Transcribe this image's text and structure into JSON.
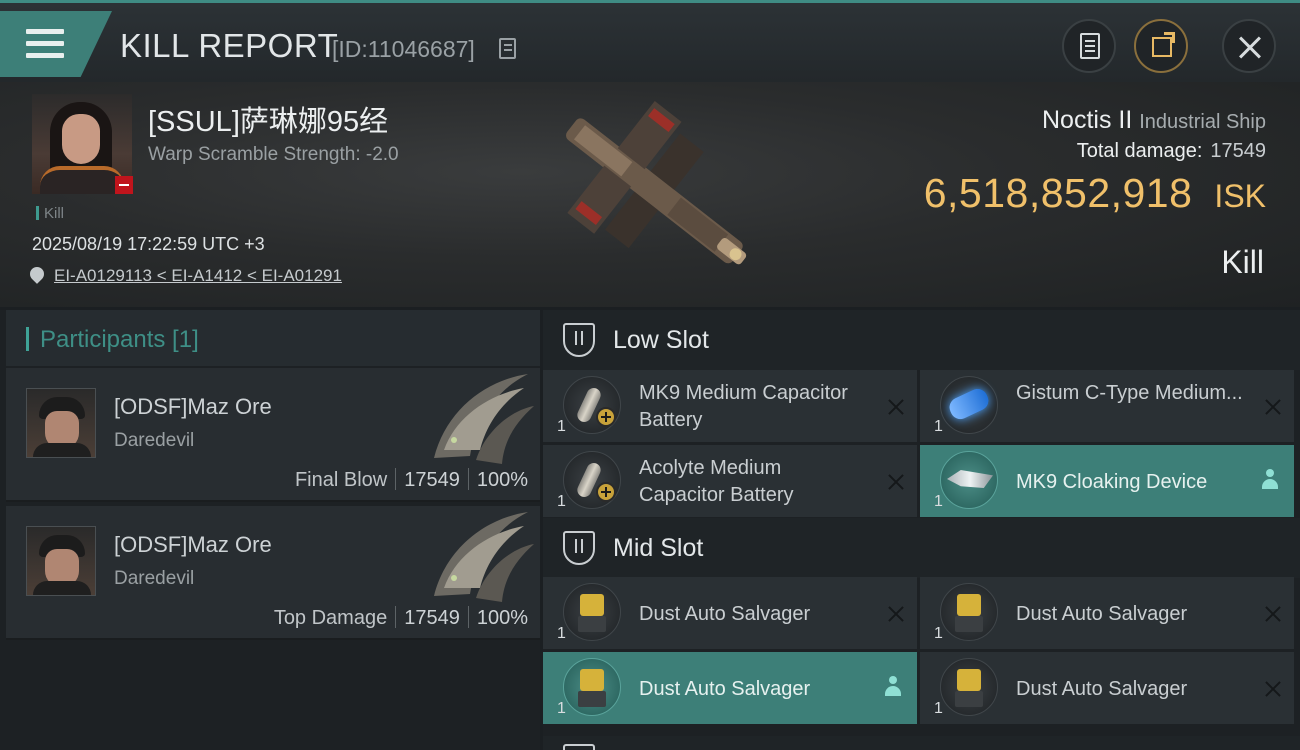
{
  "header": {
    "title": "KILL REPORT",
    "report_id": "[ID:11046687]",
    "icons": {
      "menu": "hamburger-icon",
      "copy": "copy-icon",
      "report": "clipboard-icon",
      "share": "share-icon",
      "close": "close-icon"
    }
  },
  "victim": {
    "name": "[SSUL]萨琳娜95经",
    "warp_scramble": "Warp Scramble Strength: -2.0",
    "tag": "Kill",
    "timestamp": "2025/08/19 17:22:59 UTC +3",
    "location": "EI-A0129113 < EI-A1412 < EI-A01291"
  },
  "ship": {
    "name": "Noctis II",
    "class": "Industrial Ship",
    "total_damage_label": "Total damage:",
    "total_damage_value": "17549",
    "isk_value": "6,518,852,918",
    "isk_unit": "ISK",
    "outcome": "Kill"
  },
  "participants": {
    "header": "Participants [1]",
    "rows": [
      {
        "name": "[ODSF]Maz Ore",
        "ship": "Daredevil",
        "role": "Final Blow",
        "damage": "17549",
        "percent": "100%"
      },
      {
        "name": "[ODSF]Maz Ore",
        "ship": "Daredevil",
        "role": "Top Damage",
        "damage": "17549",
        "percent": "100%"
      }
    ]
  },
  "slots": {
    "low": {
      "title": "Low Slot",
      "items": [
        {
          "qty": "1",
          "name": "MK9 Medium Capacitor Battery",
          "icon": "capacitor-battery-icon",
          "status": "destroyed"
        },
        {
          "qty": "1",
          "name": "Gistum C-Type Medium...",
          "icon": "booster-icon",
          "status": "destroyed"
        },
        {
          "qty": "1",
          "name": "Acolyte Medium Capacitor Battery",
          "icon": "capacitor-battery-icon",
          "status": "destroyed"
        },
        {
          "qty": "1",
          "name": "MK9 Cloaking Device",
          "icon": "cloaking-device-icon",
          "status": "dropped"
        }
      ]
    },
    "mid": {
      "title": "Mid Slot",
      "items": [
        {
          "qty": "1",
          "name": "Dust Auto Salvager",
          "icon": "salvager-icon",
          "status": "destroyed"
        },
        {
          "qty": "1",
          "name": "Dust Auto Salvager",
          "icon": "salvager-icon",
          "status": "destroyed"
        },
        {
          "qty": "1",
          "name": "Dust Auto Salvager",
          "icon": "salvager-icon",
          "status": "dropped"
        },
        {
          "qty": "1",
          "name": "Dust Auto Salvager",
          "icon": "salvager-icon",
          "status": "destroyed"
        }
      ]
    }
  },
  "colors": {
    "accent": "#3d7f78",
    "isk": "#f0c06a",
    "loss_badge": "#c0141c"
  }
}
